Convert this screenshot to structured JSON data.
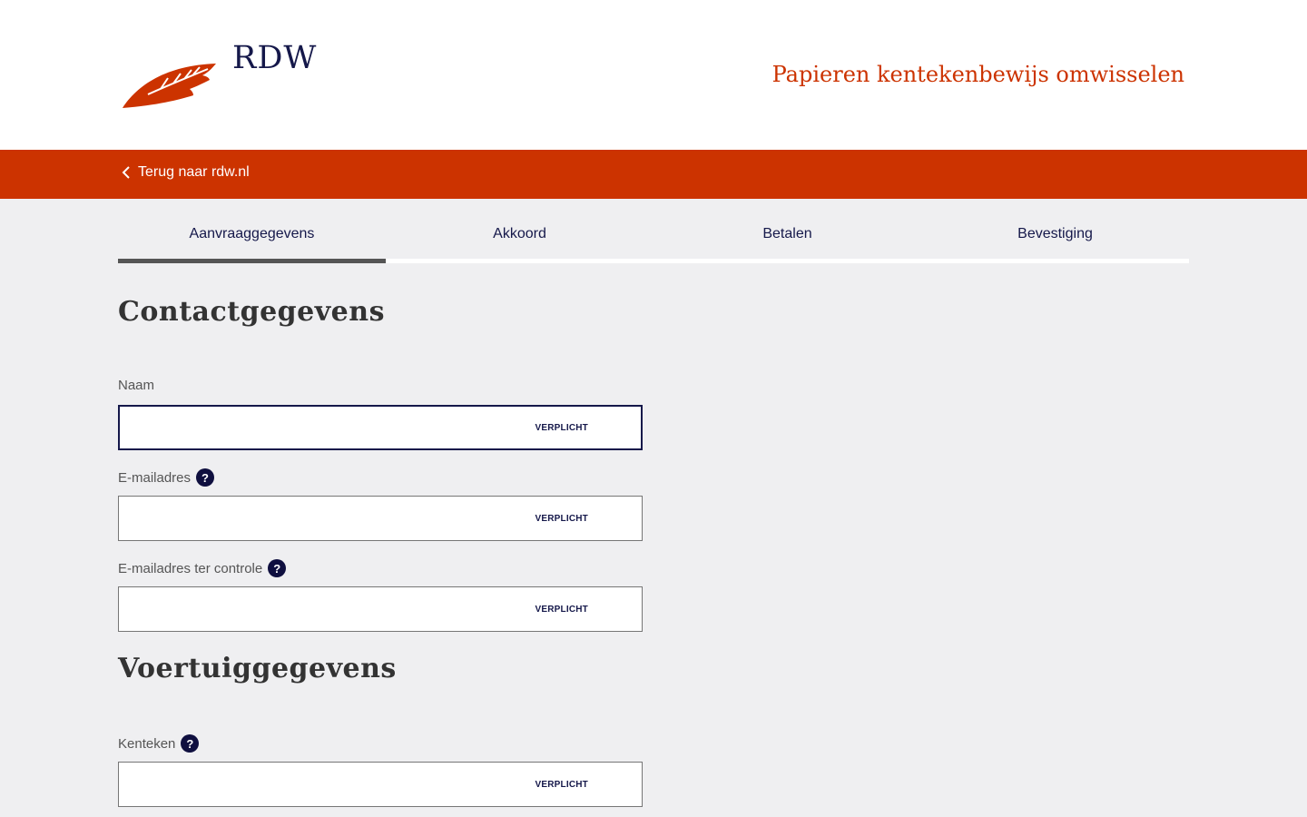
{
  "header": {
    "logo_text": "RDW",
    "site_title": "Papieren kentekenbewijs omwisselen"
  },
  "backbar": {
    "back_label": "Terug naar rdw.nl"
  },
  "steps": [
    {
      "label": "Aanvraaggegevens",
      "active": true
    },
    {
      "label": "Akkoord",
      "active": false
    },
    {
      "label": "Betalen",
      "active": false
    },
    {
      "label": "Bevestiging",
      "active": false
    }
  ],
  "contact": {
    "title": "Contactgegevens",
    "fields": [
      {
        "label": "Naam",
        "value": "",
        "required": "VERPLICHT",
        "help": false
      },
      {
        "label": "E-mailadres",
        "value": "",
        "required": "VERPLICHT",
        "help": true
      },
      {
        "label": "E-mailadres ter controle",
        "value": "",
        "required": "VERPLICHT",
        "help": true
      }
    ]
  },
  "vehicle": {
    "title": "Voertuiggegevens",
    "fields": [
      {
        "label": "Kenteken",
        "value": "",
        "required": "VERPLICHT",
        "help": true
      }
    ]
  },
  "help_glyph": "?",
  "colors": {
    "brand": "#cc3300",
    "navy": "#15184a",
    "background": "#efeff1"
  }
}
